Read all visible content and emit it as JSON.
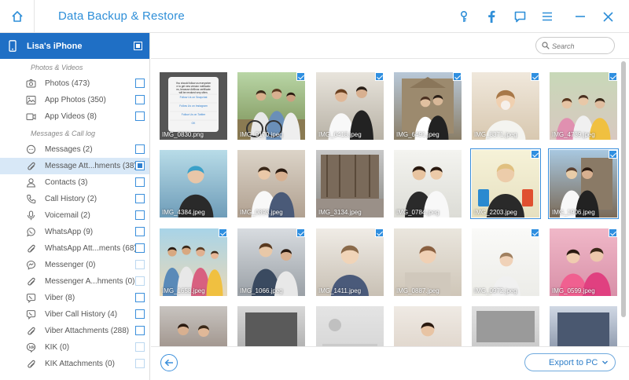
{
  "app": {
    "title": "Data Backup & Restore",
    "accent": "#2f8fd8",
    "toolbar_icons": [
      "key-icon",
      "facebook-icon",
      "feedback-icon",
      "menu-icon",
      "minimize-icon",
      "close-icon"
    ]
  },
  "device": {
    "name": "Lisa's iPhone",
    "header_color": "#1f6fc5"
  },
  "sidebar": {
    "sections": [
      {
        "label": "Photos & Videos",
        "items": [
          {
            "label": "Photos (473)",
            "icon": "camera-icon"
          },
          {
            "label": "App Photos (350)",
            "icon": "image-icon"
          },
          {
            "label": "App Videos (8)",
            "icon": "video-icon"
          }
        ]
      },
      {
        "label": "Messages & Call log",
        "items": [
          {
            "label": "Messages (2)",
            "icon": "message-icon"
          },
          {
            "label": "Message Att...hments (38)",
            "icon": "paperclip-icon",
            "selected": true
          },
          {
            "label": "Contacts (3)",
            "icon": "contacts-icon"
          },
          {
            "label": "Call History (2)",
            "icon": "phone-icon"
          },
          {
            "label": "Voicemail (2)",
            "icon": "voicemail-icon"
          },
          {
            "label": "WhatsApp (9)",
            "icon": "whatsapp-icon"
          },
          {
            "label": "WhatsApp Att...ments (68)",
            "icon": "paperclip-icon"
          },
          {
            "label": "Messenger (0)",
            "icon": "messenger-icon",
            "disabled": true
          },
          {
            "label": "Messenger A...hments (0)",
            "icon": "paperclip-icon",
            "disabled": true
          },
          {
            "label": "Viber (8)",
            "icon": "viber-icon"
          },
          {
            "label": "Viber Call History (4)",
            "icon": "viber-icon"
          },
          {
            "label": "Viber Attachments (288)",
            "icon": "paperclip-icon"
          },
          {
            "label": "KIK (0)",
            "icon": "kik-icon",
            "disabled": true
          },
          {
            "label": "KIK Attachments (0)",
            "icon": "paperclip-icon",
            "disabled": true
          }
        ]
      }
    ]
  },
  "search": {
    "placeholder": "Search",
    "value": ""
  },
  "photos": [
    {
      "name": "IMG_0830.png",
      "checked": false
    },
    {
      "name": "IMG_0170.jpeg",
      "checked": true
    },
    {
      "name": "IMG_6418.jpeg",
      "checked": true
    },
    {
      "name": "IMG_6491.jpeg",
      "checked": true
    },
    {
      "name": "IMG_8371.jpeg",
      "checked": true
    },
    {
      "name": "IMG_4739.jpeg",
      "checked": true
    },
    {
      "name": "IMG_4384.jpeg",
      "checked": false
    },
    {
      "name": "IMG_0893.jpeg",
      "checked": false
    },
    {
      "name": "IMG_3134.jpeg",
      "checked": false
    },
    {
      "name": "IMG_0784.jpeg",
      "checked": false
    },
    {
      "name": "IMG_2203.jpeg",
      "checked": true,
      "selected": true
    },
    {
      "name": "IMG_1906.jpeg",
      "checked": true,
      "selected": true
    },
    {
      "name": "IMG_1658.jpeg",
      "checked": true
    },
    {
      "name": "IMG_1066.jpeg",
      "checked": true
    },
    {
      "name": "IMG_1411.jpeg",
      "checked": true
    },
    {
      "name": "IMG_0887.jpeg",
      "checked": false
    },
    {
      "name": "IMG_0972.jpeg",
      "checked": true
    },
    {
      "name": "IMG_0599.jpeg",
      "checked": true
    },
    {
      "name": "",
      "checked": false
    },
    {
      "name": "",
      "checked": false
    },
    {
      "name": "",
      "checked": false
    },
    {
      "name": "",
      "checked": false
    },
    {
      "name": "",
      "checked": false
    },
    {
      "name": "",
      "checked": false
    }
  ],
  "popup_thumb": {
    "heading": "You should follow us everywhere to get new version notifications, because AirBnus certificate will be revoked very often.",
    "links": [
      "Follow Us on Snapchat",
      "Follow Us on Instagram",
      "Follow Us on Twitter",
      "OK"
    ]
  },
  "footer": {
    "export_label": "Export to PC"
  }
}
